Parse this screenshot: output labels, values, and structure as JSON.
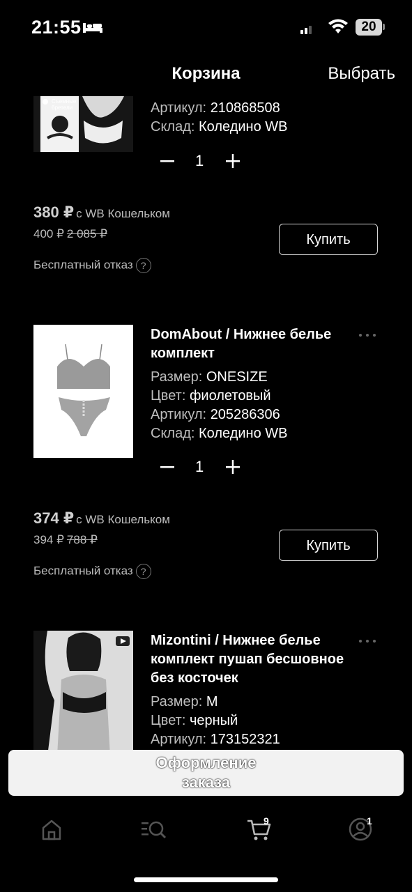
{
  "status_bar": {
    "time": "21:55",
    "battery": "20"
  },
  "header": {
    "title": "Корзина",
    "select_label": "Выбрать"
  },
  "items": [
    {
      "image_caption": "Съемные бретели",
      "article_key": "Артикул:",
      "article_value": "210868508",
      "warehouse_key": "Склад:",
      "warehouse_value": "Коледино WB",
      "quantity": "1",
      "price_main": "380 ₽",
      "price_wallet_label": "с WB Кошельком",
      "price_regular": "400 ₽",
      "price_old": "2 085 ₽",
      "refund_label": "Бесплатный отказ",
      "buy_label": "Купить"
    },
    {
      "name": "DomAbout / Нижнее белье комплект",
      "size_key": "Размер:",
      "size_value": "ONESIZE",
      "color_key": "Цвет:",
      "color_value": "фиолетовый",
      "article_key": "Артикул:",
      "article_value": "205286306",
      "warehouse_key": "Склад:",
      "warehouse_value": "Коледино WB",
      "quantity": "1",
      "price_main": "374 ₽",
      "price_wallet_label": "с WB Кошельком",
      "price_regular": "394 ₽",
      "price_old": "788 ₽",
      "refund_label": "Бесплатный отказ",
      "buy_label": "Купить"
    },
    {
      "name": "Mizontini / Нижнее белье комплект пушап бесшовное без косточек",
      "size_key": "Размер:",
      "size_value": "M",
      "color_key": "Цвет:",
      "color_value": "черный",
      "article_key": "Артикул:",
      "article_value": "173152321"
    }
  ],
  "checkout": {
    "line1": "Оформление",
    "line2": "заказа"
  },
  "bottom_nav": {
    "cart_badge": "9",
    "profile_badge": "1"
  },
  "colors": {
    "background": "#000000",
    "text": "#ffffff",
    "muted": "#bdbdbd",
    "checkout_bg": "#f2f2f2"
  }
}
